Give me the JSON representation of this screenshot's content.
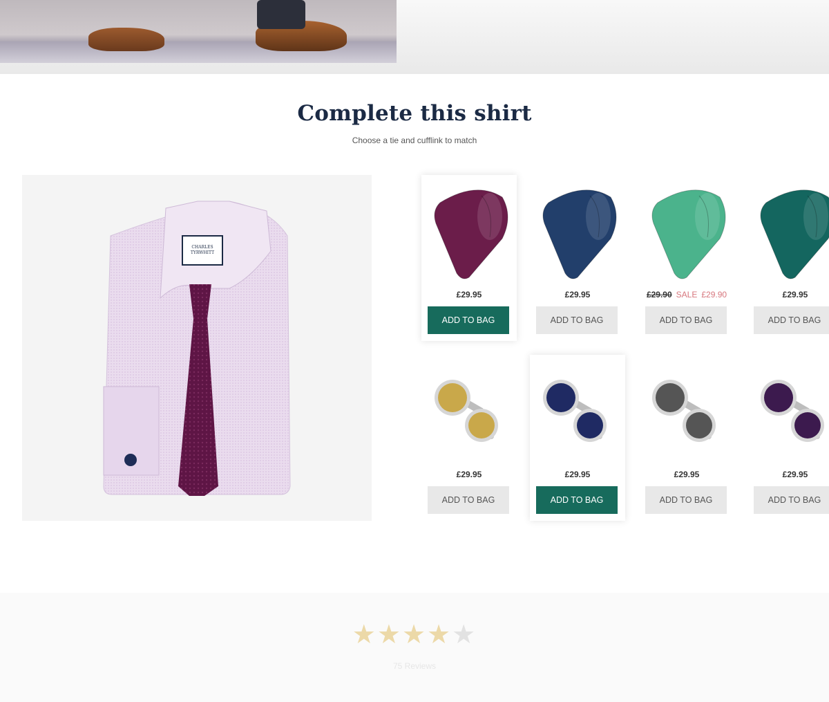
{
  "section": {
    "title": "Complete this shirt",
    "subtitle": "Choose a tie and cufflink to match"
  },
  "ties": [
    {
      "color": "#6b1d4a",
      "price": "£29.95",
      "button": "ADD TO BAG",
      "selected": true
    },
    {
      "color": "#223f6b",
      "price": "£29.95",
      "button": "ADD TO BAG",
      "selected": false
    },
    {
      "color": "#4bb38c",
      "old_price": "£29.90",
      "sale_label": "SALE",
      "sale_price": "£29.90",
      "button": "ADD TO BAG",
      "selected": false
    },
    {
      "color": "#14665f",
      "price": "£29.95",
      "button": "ADD TO BAG",
      "selected": false
    }
  ],
  "cufflinks": [
    {
      "color": "#c9a84a",
      "price": "£29.95",
      "button": "ADD TO BAG",
      "selected": false
    },
    {
      "color": "#1f2a63",
      "price": "£29.95",
      "button": "ADD TO BAG",
      "selected": true
    },
    {
      "color": "#555555",
      "price": "£29.95",
      "button": "ADD TO BAG",
      "selected": false
    },
    {
      "color": "#3c1a4e",
      "price": "£29.95",
      "button": "ADD TO BAG",
      "selected": false
    }
  ],
  "reviews": {
    "rating": 4,
    "max": 5,
    "count_text": "75 Reviews"
  }
}
